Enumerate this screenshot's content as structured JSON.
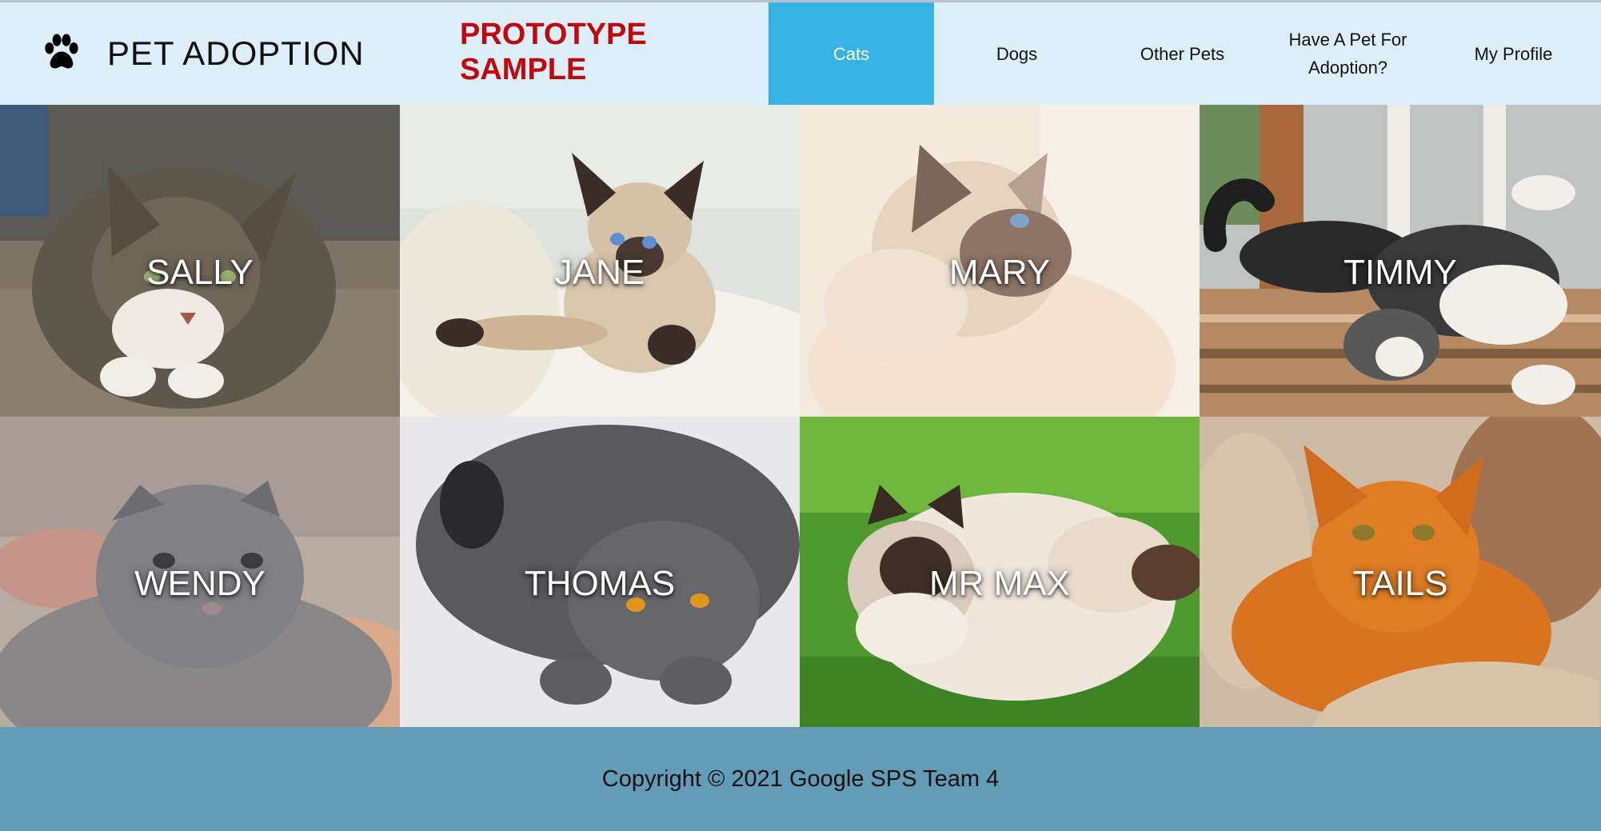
{
  "header": {
    "logo_icon": "paw-icon",
    "title": "PET ADOPTION",
    "badge_line1": "PROTOTYPE",
    "badge_line2": "SAMPLE",
    "badge_color": "#c0090e",
    "background": "#dceef7"
  },
  "nav": {
    "active_color": "#35b3e4",
    "items": [
      {
        "label": "Cats",
        "active": true
      },
      {
        "label": "Dogs",
        "active": false
      },
      {
        "label": "Other Pets",
        "active": false
      },
      {
        "label": "Have A Pet For Adoption?",
        "active": false
      },
      {
        "label": "My Profile",
        "active": false
      }
    ]
  },
  "pets": [
    {
      "name": "SALLY"
    },
    {
      "name": "JANE"
    },
    {
      "name": "MARY"
    },
    {
      "name": "TIMMY"
    },
    {
      "name": "WENDY"
    },
    {
      "name": "THOMAS"
    },
    {
      "name": "MR MAX"
    },
    {
      "name": "TAILS"
    }
  ],
  "footer": {
    "text": "Copyright © 2021 Google SPS Team 4",
    "background": "#629cb7"
  }
}
